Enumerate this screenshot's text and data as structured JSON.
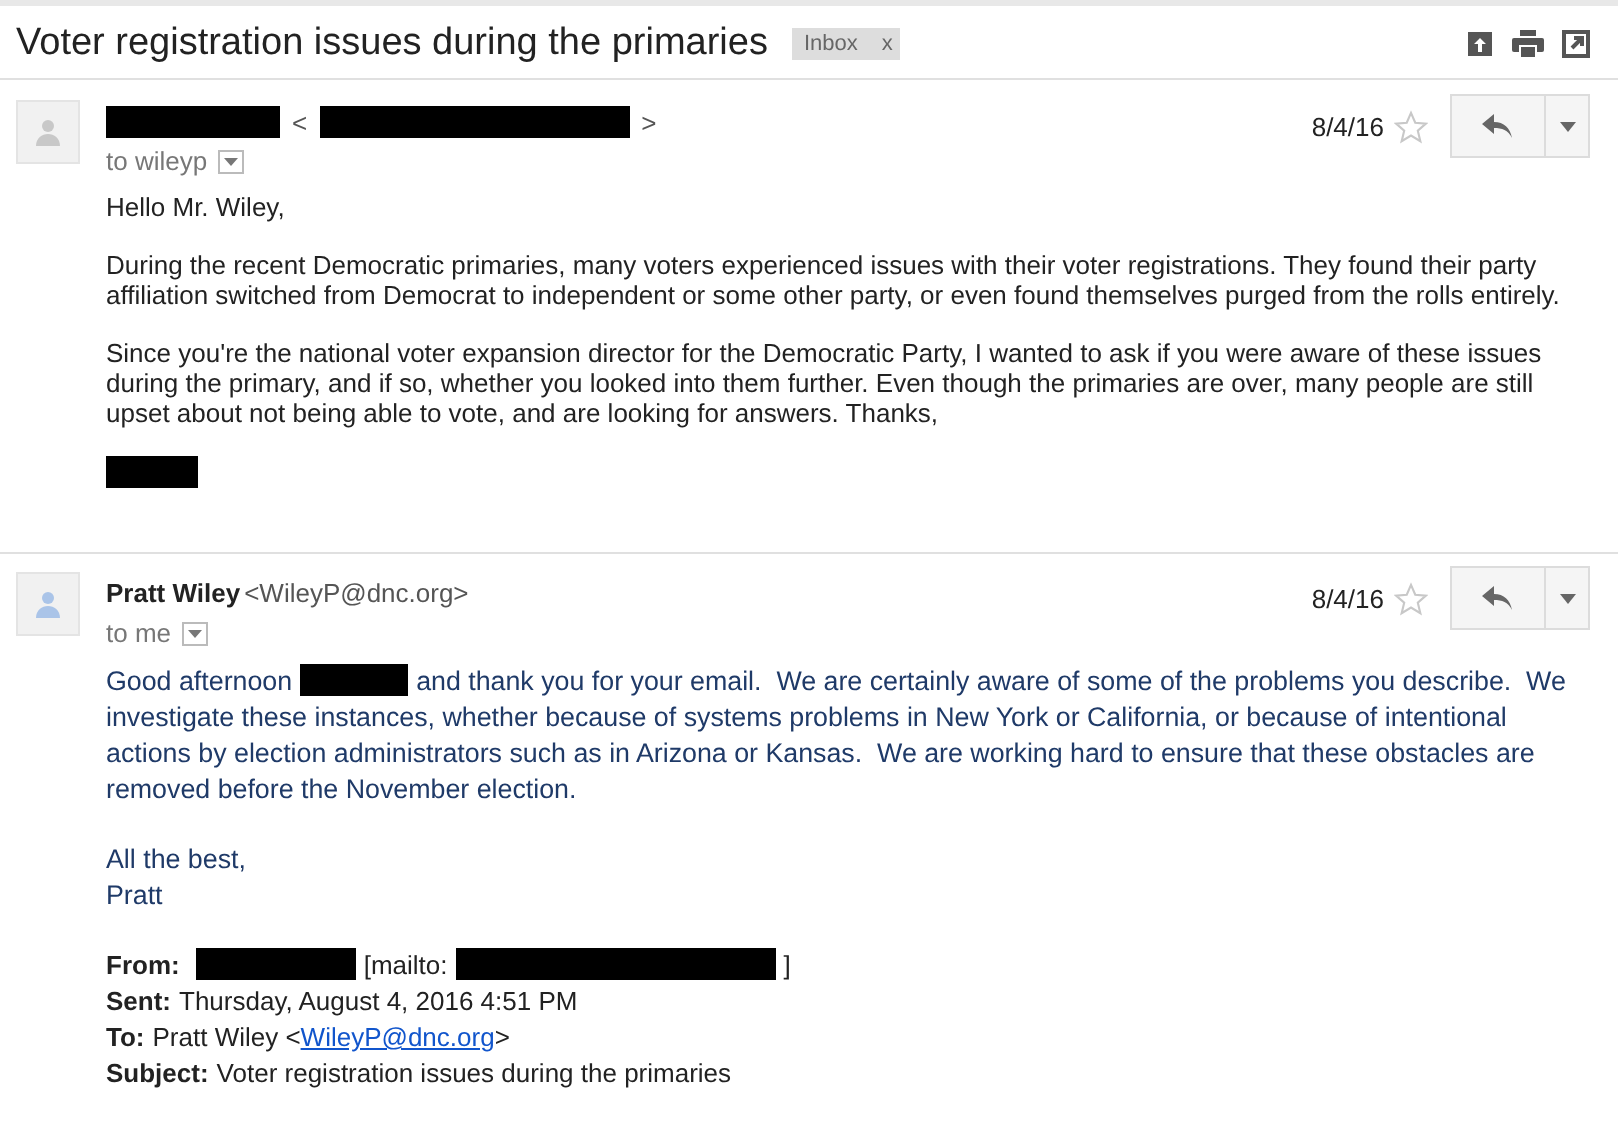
{
  "thread": {
    "subject": "Voter registration issues during the primaries",
    "labels": [
      {
        "text": "Inbox",
        "remove": "x"
      }
    ]
  },
  "messages": [
    {
      "kind": "plain",
      "sender": [
        {
          "kind": "redacted"
        },
        {
          "kind": "text",
          "text": "<"
        },
        {
          "kind": "redacted"
        },
        {
          "kind": "text",
          "text": ">"
        }
      ],
      "recipient": "to wileyp",
      "date": "8/4/16",
      "starred": false,
      "body": [
        [
          {
            "kind": "text",
            "text": "Hello Mr. Wiley,"
          }
        ],
        [
          {
            "kind": "text",
            "text": "During the recent Democratic primaries, many voters experienced issues with their voter registrations. They found their party affiliation switched from Democrat to independent or some other party, or even found themselves purged from the rolls entirely."
          }
        ],
        [
          {
            "kind": "text",
            "text": "Since you're the national voter expansion director for the Democratic Party, I wanted to ask if you were aware of these issues during the primary, and if so, whether you looked into them further. Even though the primaries are over, many people are still upset about not being able to vote, and are looking for answers. Thanks,"
          }
        ],
        [
          {
            "kind": "redacted"
          }
        ]
      ]
    },
    {
      "kind": "formatted",
      "sender": [
        {
          "kind": "name",
          "text": "Pratt Wiley"
        },
        {
          "kind": "text",
          "text": "<WileyP@dnc.org>"
        }
      ],
      "recipient": "to me",
      "date": "8/4/16",
      "starred": false,
      "body": [
        [
          {
            "kind": "line",
            "text": "Good afternoon"
          },
          {
            "kind": "redacted"
          },
          {
            "kind": "line",
            "text": "and thank you for your email.  We are certainly aware of some of the problems you describe.  We"
          },
          {
            "kind": "block",
            "text": "investigate these instances, whether because of systems problems in New York or California, or because of intentional actions by election administrators such as in Arizona or Kansas.  We are working hard to ensure that these obstacles are removed before the November election."
          }
        ],
        [
          {
            "kind": "block",
            "text": "All the best,"
          },
          {
            "kind": "block",
            "text": "Pratt"
          }
        ]
      ],
      "quoted": [
        [
          {
            "kind": "label",
            "text": "From:"
          },
          {
            "kind": "redacted"
          },
          {
            "kind": "text",
            "text": "[mailto:"
          },
          {
            "kind": "redacted"
          },
          {
            "kind": "text",
            "text": "]"
          }
        ],
        [
          {
            "kind": "label",
            "text": "Sent:"
          },
          {
            "kind": "text",
            "text": "Thursday, August 4, 2016 4:51 PM"
          }
        ],
        [
          {
            "kind": "label",
            "text": "To:"
          },
          {
            "kind": "text",
            "text": "Pratt Wiley <"
          },
          {
            "kind": "link",
            "text": "WileyP@dnc.org"
          },
          {
            "kind": "text",
            "text": ">"
          }
        ],
        [
          {
            "kind": "label",
            "text": "Subject:"
          },
          {
            "kind": "text",
            "text": "Voter registration issues during the primaries"
          }
        ]
      ]
    }
  ]
}
